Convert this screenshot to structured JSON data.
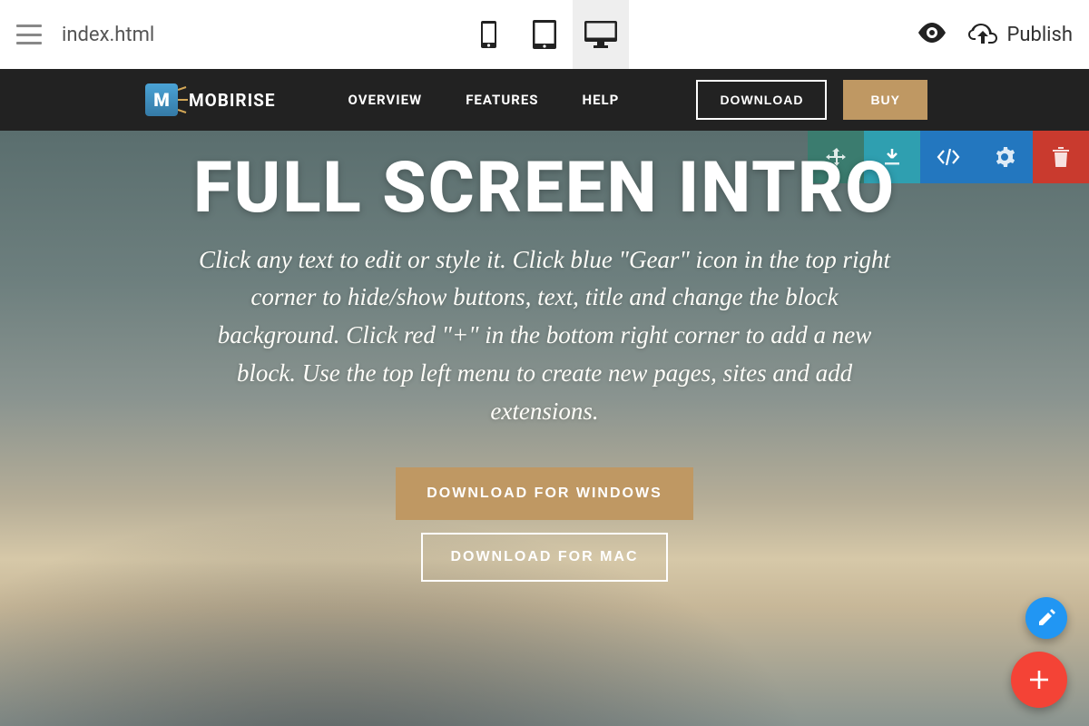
{
  "app": {
    "filename": "index.html",
    "publish_label": "Publish"
  },
  "site_nav": {
    "brand": "MOBIRISE",
    "links": [
      "OVERVIEW",
      "FEATURES",
      "HELP"
    ],
    "download_label": "DOWNLOAD",
    "buy_label": "BUY"
  },
  "hero": {
    "title": "FULL SCREEN INTRO",
    "description": "Click any text to edit or style it. Click blue \"Gear\" icon in the top right corner to hide/show buttons, text, title and change the block background. Click red \"+\" in the bottom right corner to add a new block. Use the top left menu to create new pages, sites and add extensions.",
    "btn_windows": "DOWNLOAD FOR WINDOWS",
    "btn_mac": "DOWNLOAD FOR MAC"
  }
}
